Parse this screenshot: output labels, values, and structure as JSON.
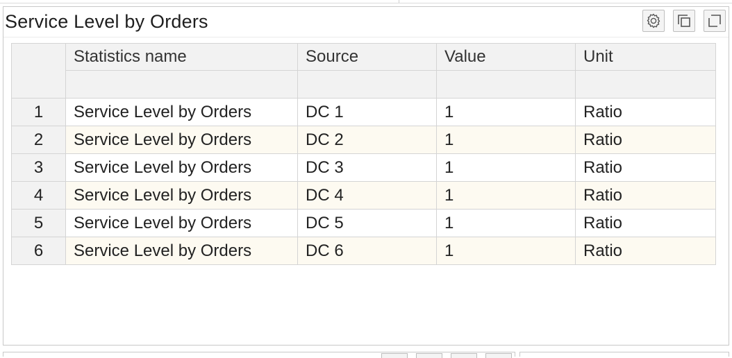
{
  "panel": {
    "title": "Service Level by Orders",
    "tools": [
      "settings-icon",
      "duplicate-icon",
      "maximize-icon"
    ]
  },
  "table": {
    "columns": [
      "Statistics name",
      "Source",
      "Value",
      "Unit"
    ],
    "rows": [
      {
        "num": "1",
        "name": "Service Level by Orders",
        "source": "DC 1",
        "value": "1",
        "unit": "Ratio"
      },
      {
        "num": "2",
        "name": "Service Level by Orders",
        "source": "DC 2",
        "value": "1",
        "unit": "Ratio"
      },
      {
        "num": "3",
        "name": "Service Level by Orders",
        "source": "DC 3",
        "value": "1",
        "unit": "Ratio"
      },
      {
        "num": "4",
        "name": "Service Level by Orders",
        "source": "DC 4",
        "value": "1",
        "unit": "Ratio"
      },
      {
        "num": "5",
        "name": "Service Level by Orders",
        "source": "DC 5",
        "value": "1",
        "unit": "Ratio"
      },
      {
        "num": "6",
        "name": "Service Level by Orders",
        "source": "DC 6",
        "value": "1",
        "unit": "Ratio"
      }
    ]
  }
}
